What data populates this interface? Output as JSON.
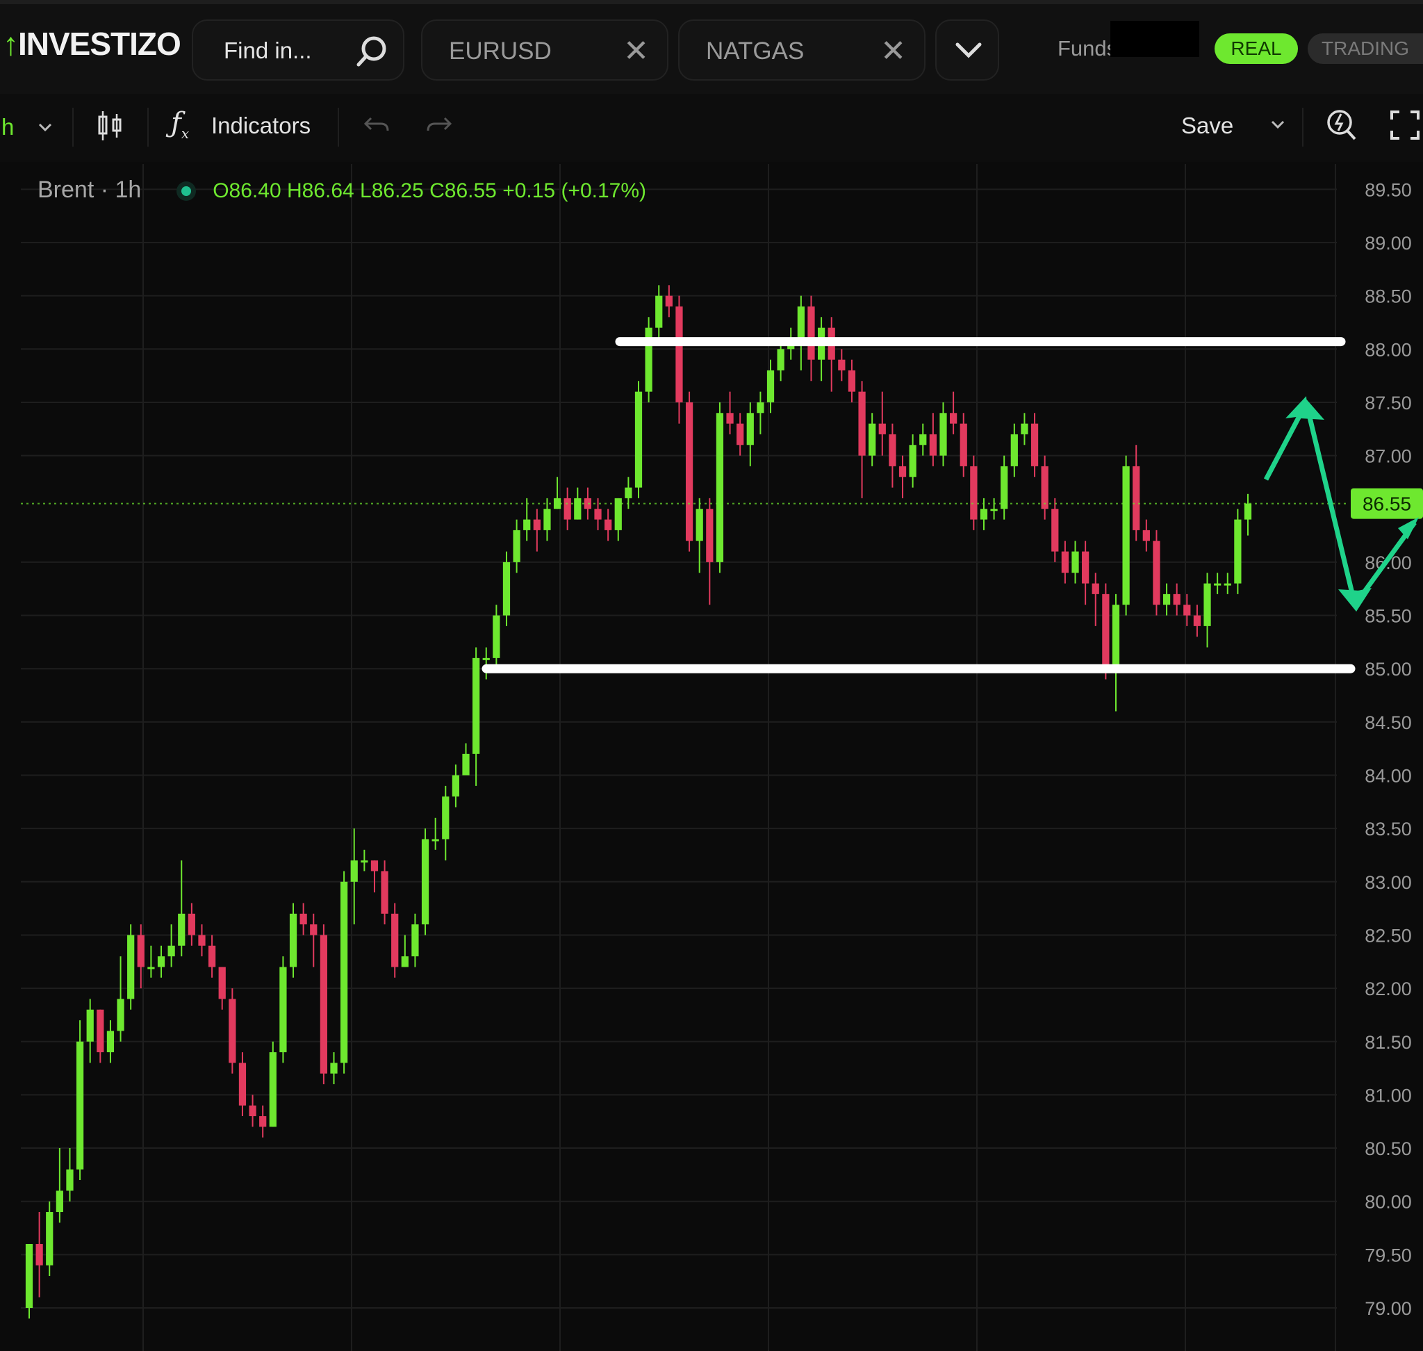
{
  "app": {
    "logo_text": "INVESTIZO"
  },
  "topbar": {
    "search_placeholder": "Find in...",
    "tabs": [
      {
        "label": "EURUSD",
        "close": "✕"
      },
      {
        "label": "NATGAS",
        "close": "✕"
      }
    ],
    "funds_label": "Funds",
    "mode_real": "REAL",
    "mode_trading": "TRADING"
  },
  "toolbar": {
    "interval": "h",
    "indicators_label": "Indicators",
    "save_label": "Save"
  },
  "legend": {
    "symbol": "Brent · 1h",
    "ohlc": "O86.40  H86.64  L86.25  C86.55  +0.15 (+0.17%)"
  },
  "chart_data": {
    "type": "candlestick",
    "symbol": "Brent",
    "interval": "1h",
    "y_ticks": [
      "89.50",
      "89.00",
      "88.50",
      "88.00",
      "87.50",
      "87.00",
      "86.55",
      "86.00",
      "85.50",
      "85.00",
      "84.50",
      "84.00",
      "83.50",
      "83.00",
      "82.50",
      "82.00",
      "81.50",
      "81.00",
      "80.50",
      "80.00",
      "79.50",
      "79.00"
    ],
    "ylim": [
      78.65,
      89.75
    ],
    "last_price": 86.55,
    "last_price_label": "86.55",
    "resistance": 88.07,
    "support": 85.0,
    "candles": [
      [
        79.0,
        79.6,
        78.9,
        79.6
      ],
      [
        79.6,
        79.4,
        79.1,
        79.9
      ],
      [
        79.4,
        79.9,
        79.3,
        80.0
      ],
      [
        79.9,
        80.1,
        79.8,
        80.5
      ],
      [
        80.1,
        80.3,
        80.0,
        80.5
      ],
      [
        80.3,
        81.5,
        80.2,
        81.7
      ],
      [
        81.5,
        81.8,
        81.3,
        81.9
      ],
      [
        81.8,
        81.4,
        81.3,
        81.8
      ],
      [
        81.4,
        81.6,
        81.3,
        81.7
      ],
      [
        81.6,
        81.9,
        81.5,
        82.3
      ],
      [
        81.9,
        82.5,
        81.8,
        82.6
      ],
      [
        82.5,
        82.2,
        82.0,
        82.6
      ],
      [
        82.2,
        82.2,
        82.1,
        82.4
      ],
      [
        82.2,
        82.3,
        82.1,
        82.4
      ],
      [
        82.3,
        82.4,
        82.2,
        82.6
      ],
      [
        82.4,
        82.7,
        82.3,
        83.2
      ],
      [
        82.7,
        82.5,
        82.4,
        82.8
      ],
      [
        82.5,
        82.4,
        82.3,
        82.6
      ],
      [
        82.4,
        82.2,
        82.1,
        82.5
      ],
      [
        82.2,
        81.9,
        81.8,
        82.2
      ],
      [
        81.9,
        81.3,
        81.2,
        82.0
      ],
      [
        81.3,
        80.9,
        80.8,
        81.4
      ],
      [
        80.9,
        80.8,
        80.7,
        81.0
      ],
      [
        80.8,
        80.7,
        80.6,
        80.9
      ],
      [
        80.7,
        81.4,
        80.7,
        81.5
      ],
      [
        81.4,
        82.2,
        81.3,
        82.3
      ],
      [
        82.2,
        82.7,
        82.1,
        82.8
      ],
      [
        82.7,
        82.6,
        82.5,
        82.8
      ],
      [
        82.6,
        82.5,
        82.2,
        82.7
      ],
      [
        82.5,
        81.2,
        81.1,
        82.6
      ],
      [
        81.2,
        81.3,
        81.1,
        81.4
      ],
      [
        81.3,
        83.0,
        81.2,
        83.1
      ],
      [
        83.0,
        83.2,
        82.6,
        83.5
      ],
      [
        83.2,
        83.2,
        83.1,
        83.3
      ],
      [
        83.2,
        83.1,
        82.9,
        83.2
      ],
      [
        83.1,
        82.7,
        82.6,
        83.2
      ],
      [
        82.7,
        82.2,
        82.1,
        82.8
      ],
      [
        82.2,
        82.3,
        82.2,
        82.5
      ],
      [
        82.3,
        82.6,
        82.2,
        82.7
      ],
      [
        82.6,
        83.4,
        82.5,
        83.5
      ],
      [
        83.4,
        83.4,
        83.3,
        83.6
      ],
      [
        83.4,
        83.8,
        83.2,
        83.9
      ],
      [
        83.8,
        84.0,
        83.7,
        84.1
      ],
      [
        84.0,
        84.2,
        84.0,
        84.3
      ],
      [
        84.2,
        85.1,
        83.9,
        85.2
      ],
      [
        85.1,
        85.1,
        84.9,
        85.2
      ],
      [
        85.1,
        85.5,
        85.0,
        85.6
      ],
      [
        85.5,
        86.0,
        85.4,
        86.1
      ],
      [
        86.0,
        86.3,
        85.9,
        86.4
      ],
      [
        86.3,
        86.4,
        86.2,
        86.6
      ],
      [
        86.4,
        86.3,
        86.1,
        86.5
      ],
      [
        86.3,
        86.5,
        86.2,
        86.6
      ],
      [
        86.5,
        86.6,
        86.5,
        86.8
      ],
      [
        86.6,
        86.4,
        86.3,
        86.7
      ],
      [
        86.4,
        86.6,
        86.4,
        86.7
      ],
      [
        86.6,
        86.5,
        86.4,
        86.7
      ],
      [
        86.5,
        86.4,
        86.3,
        86.6
      ],
      [
        86.4,
        86.3,
        86.2,
        86.5
      ],
      [
        86.3,
        86.6,
        86.2,
        86.6
      ],
      [
        86.6,
        86.7,
        86.5,
        86.8
      ],
      [
        86.7,
        87.6,
        86.6,
        87.7
      ],
      [
        87.6,
        88.2,
        87.5,
        88.3
      ],
      [
        88.2,
        88.5,
        88.1,
        88.6
      ],
      [
        88.5,
        88.4,
        88.3,
        88.6
      ],
      [
        88.4,
        87.5,
        87.3,
        88.5
      ],
      [
        87.5,
        86.2,
        86.1,
        87.6
      ],
      [
        86.2,
        86.5,
        85.9,
        86.6
      ],
      [
        86.5,
        86.0,
        85.6,
        86.6
      ],
      [
        86.0,
        87.4,
        85.9,
        87.5
      ],
      [
        87.4,
        87.3,
        87.2,
        87.6
      ],
      [
        87.3,
        87.1,
        87.0,
        87.4
      ],
      [
        87.1,
        87.4,
        86.9,
        87.5
      ],
      [
        87.4,
        87.5,
        87.2,
        87.6
      ],
      [
        87.5,
        87.8,
        87.4,
        87.9
      ],
      [
        87.8,
        88.0,
        87.7,
        88.1
      ],
      [
        88.0,
        88.1,
        87.9,
        88.2
      ],
      [
        88.1,
        88.4,
        87.8,
        88.5
      ],
      [
        88.4,
        87.9,
        87.7,
        88.5
      ],
      [
        87.9,
        88.2,
        87.7,
        88.3
      ],
      [
        88.2,
        87.9,
        87.6,
        88.3
      ],
      [
        87.9,
        87.8,
        87.7,
        88.0
      ],
      [
        87.8,
        87.6,
        87.5,
        87.9
      ],
      [
        87.6,
        87.0,
        86.6,
        87.7
      ],
      [
        87.0,
        87.3,
        86.9,
        87.4
      ],
      [
        87.3,
        87.2,
        87.0,
        87.6
      ],
      [
        87.2,
        86.9,
        86.7,
        87.3
      ],
      [
        86.9,
        86.8,
        86.6,
        87.0
      ],
      [
        86.8,
        87.1,
        86.7,
        87.2
      ],
      [
        87.1,
        87.2,
        87.0,
        87.3
      ],
      [
        87.2,
        87.0,
        86.9,
        87.4
      ],
      [
        87.0,
        87.4,
        86.9,
        87.5
      ],
      [
        87.4,
        87.3,
        87.2,
        87.6
      ],
      [
        87.3,
        86.9,
        86.8,
        87.4
      ],
      [
        86.9,
        86.4,
        86.3,
        87.0
      ],
      [
        86.4,
        86.5,
        86.3,
        86.6
      ],
      [
        86.5,
        86.5,
        86.4,
        86.6
      ],
      [
        86.5,
        86.9,
        86.4,
        87.0
      ],
      [
        86.9,
        87.2,
        86.8,
        87.3
      ],
      [
        87.2,
        87.3,
        87.1,
        87.4
      ],
      [
        87.3,
        86.9,
        86.8,
        87.4
      ],
      [
        86.9,
        86.5,
        86.4,
        87.0
      ],
      [
        86.5,
        86.1,
        86.0,
        86.6
      ],
      [
        86.1,
        85.9,
        85.8,
        86.2
      ],
      [
        85.9,
        86.1,
        85.8,
        86.2
      ],
      [
        86.1,
        85.8,
        85.6,
        86.2
      ],
      [
        85.8,
        85.7,
        85.4,
        85.9
      ],
      [
        85.7,
        85.0,
        84.9,
        85.8
      ],
      [
        85.0,
        85.6,
        84.6,
        85.7
      ],
      [
        85.6,
        86.9,
        85.5,
        87.0
      ],
      [
        86.9,
        86.3,
        86.2,
        87.1
      ],
      [
        86.3,
        86.2,
        86.1,
        86.4
      ],
      [
        86.2,
        85.6,
        85.5,
        86.3
      ],
      [
        85.6,
        85.7,
        85.5,
        85.8
      ],
      [
        85.7,
        85.6,
        85.5,
        85.8
      ],
      [
        85.6,
        85.5,
        85.4,
        85.7
      ],
      [
        85.5,
        85.4,
        85.3,
        85.6
      ],
      [
        85.4,
        85.8,
        85.2,
        85.9
      ],
      [
        85.8,
        85.8,
        85.7,
        85.9
      ],
      [
        85.8,
        85.8,
        85.7,
        85.9
      ],
      [
        85.8,
        86.4,
        85.7,
        86.5
      ],
      [
        86.4,
        86.55,
        86.25,
        86.64
      ]
    ]
  },
  "drawings": {
    "line_color": "#ffffff",
    "arrow_color": "#1fd38a"
  },
  "colors": {
    "up": "#6ee82f",
    "down": "#e23a5e",
    "grid": "#1e1e1e",
    "bg": "#0b0b0b"
  }
}
